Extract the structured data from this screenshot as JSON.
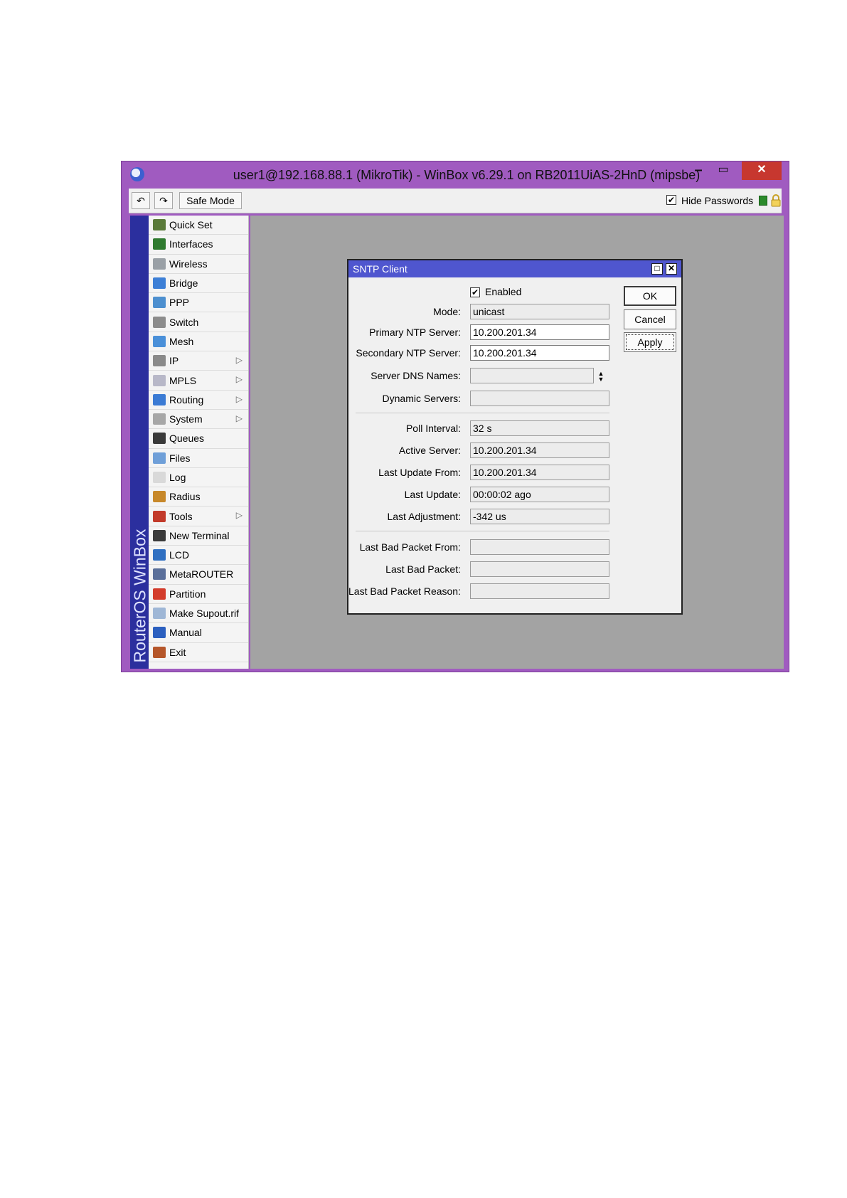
{
  "window": {
    "title": "user1@192.168.88.1 (MikroTik) - WinBox v6.29.1 on RB2011UiAS-2HnD (mipsbe)",
    "min_glyph": "–",
    "max_glyph": "▭",
    "close_glyph": "✕"
  },
  "toolbar": {
    "undo_glyph": "↶",
    "redo_glyph": "↷",
    "safe_mode_label": "Safe Mode",
    "hide_passwords_label": "Hide Passwords",
    "hide_passwords_checked": "✔"
  },
  "sidebar": {
    "brand": "RouterOS WinBox",
    "items": [
      {
        "label": "Quick Set",
        "icon": "quick-set-icon",
        "color": "#5a7a3a"
      },
      {
        "label": "Interfaces",
        "icon": "interfaces-icon",
        "color": "#2f7a2f"
      },
      {
        "label": "Wireless",
        "icon": "wireless-icon",
        "color": "#9aa0a6"
      },
      {
        "label": "Bridge",
        "icon": "bridge-icon",
        "color": "#3d7fd6"
      },
      {
        "label": "PPP",
        "icon": "ppp-icon",
        "color": "#4d8fcf"
      },
      {
        "label": "Switch",
        "icon": "switch-icon",
        "color": "#8c8c8c"
      },
      {
        "label": "Mesh",
        "icon": "mesh-icon",
        "color": "#4a90d9"
      },
      {
        "label": "IP",
        "icon": "ip-icon",
        "color": "#8a8a8a",
        "submenu": true
      },
      {
        "label": "MPLS",
        "icon": "mpls-icon",
        "color": "#b8b8c8",
        "submenu": true
      },
      {
        "label": "Routing",
        "icon": "routing-icon",
        "color": "#3b7bd4",
        "submenu": true
      },
      {
        "label": "System",
        "icon": "system-icon",
        "color": "#a7a7a7",
        "submenu": true
      },
      {
        "label": "Queues",
        "icon": "queues-icon",
        "color": "#3a3a3a"
      },
      {
        "label": "Files",
        "icon": "files-icon",
        "color": "#6f9fd8"
      },
      {
        "label": "Log",
        "icon": "log-icon",
        "color": "#d9d9d9"
      },
      {
        "label": "Radius",
        "icon": "radius-icon",
        "color": "#c7882a"
      },
      {
        "label": "Tools",
        "icon": "tools-icon",
        "color": "#c23a2a",
        "submenu": true
      },
      {
        "label": "New Terminal",
        "icon": "terminal-icon",
        "color": "#3a3a3a"
      },
      {
        "label": "LCD",
        "icon": "lcd-icon",
        "color": "#2f6fc1"
      },
      {
        "label": "MetaROUTER",
        "icon": "metarouter-icon",
        "color": "#5a6f9a"
      },
      {
        "label": "Partition",
        "icon": "partition-icon",
        "color": "#d33c2c"
      },
      {
        "label": "Make Supout.rif",
        "icon": "supout-icon",
        "color": "#9fb7d6"
      },
      {
        "label": "Manual",
        "icon": "manual-icon",
        "color": "#2b5fbf"
      },
      {
        "label": "Exit",
        "icon": "exit-icon",
        "color": "#b5562a"
      }
    ]
  },
  "dialog": {
    "title": "SNTP Client",
    "enabled_label": "Enabled",
    "enabled_checked": "✔",
    "fields": {
      "mode": {
        "label": "Mode:",
        "value": "unicast"
      },
      "primary": {
        "label": "Primary NTP Server:",
        "value": "10.200.201.34"
      },
      "secondary": {
        "label": "Secondary NTP Server:",
        "value": "10.200.201.34"
      },
      "dns_names": {
        "label": "Server DNS Names:",
        "value": ""
      },
      "dynamic": {
        "label": "Dynamic Servers:",
        "value": ""
      },
      "poll": {
        "label": "Poll Interval:",
        "value": "32 s"
      },
      "active": {
        "label": "Active Server:",
        "value": "10.200.201.34"
      },
      "last_from": {
        "label": "Last Update From:",
        "value": "10.200.201.34"
      },
      "last_update": {
        "label": "Last Update:",
        "value": "00:00:02 ago"
      },
      "last_adj": {
        "label": "Last Adjustment:",
        "value": "-342 us"
      },
      "bad_from": {
        "label": "Last Bad Packet From:",
        "value": ""
      },
      "bad_packet": {
        "label": "Last Bad Packet:",
        "value": ""
      },
      "bad_reason": {
        "label": "Last Bad Packet Reason:",
        "value": ""
      }
    },
    "buttons": {
      "ok": "OK",
      "cancel": "Cancel",
      "apply": "Apply"
    }
  }
}
